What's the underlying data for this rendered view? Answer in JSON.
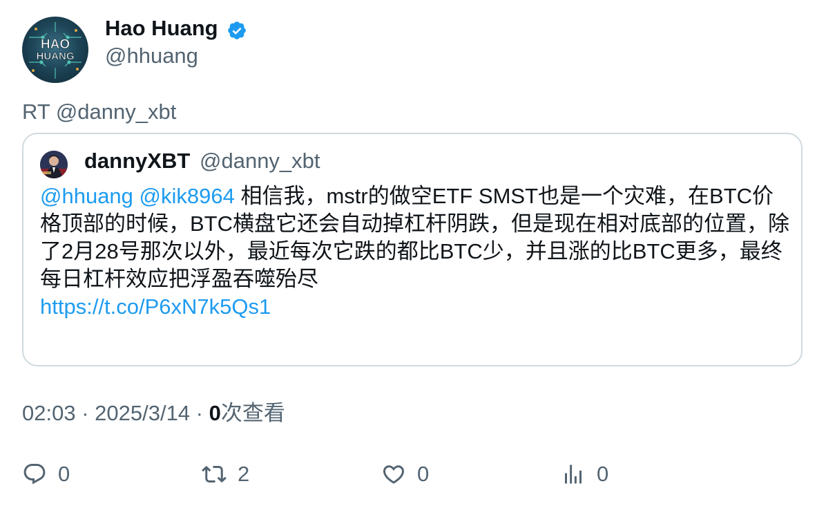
{
  "author": {
    "display_name": "Hao Huang",
    "handle": "@hhuang",
    "verified": true,
    "avatar_text": [
      "HAO",
      "HUANG"
    ],
    "verified_color": "#1d9bf0"
  },
  "retweet_line": "RT @danny_xbt",
  "quote": {
    "display_name": "dannyXBT",
    "handle": "@danny_xbt",
    "mention_1": "@hhuang",
    "mention_2": "@kik8964",
    "text": " 相信我，mstr的做空ETF SMST也是一个灾难，在BTC价格顶部的时候，BTC横盘它还会自动掉杠杆阴跌，但是现在相对底部的位置，除了2月28号那次以外，最近每次它跌的都比BTC少，并且涨的比BTC更多，最终每日杠杆效应把浮盈吞噬殆尽",
    "link": "https://t.co/P6xN7k5Qs1"
  },
  "meta": {
    "time": "02:03",
    "sep1": " · ",
    "date": "2025/3/14",
    "sep2": " · ",
    "view_count": "0",
    "view_label": "次查看"
  },
  "actions": {
    "reply_count": "0",
    "retweet_count": "2",
    "like_count": "0",
    "views_count": "0",
    "reply_icon": "reply-icon",
    "retweet_icon": "retweet-icon",
    "like_icon": "heart-icon",
    "views_icon": "views-icon"
  },
  "colors": {
    "text_primary": "#0f1419",
    "text_secondary": "#536471",
    "link": "#1d9bf0",
    "border": "#cfd9de"
  }
}
